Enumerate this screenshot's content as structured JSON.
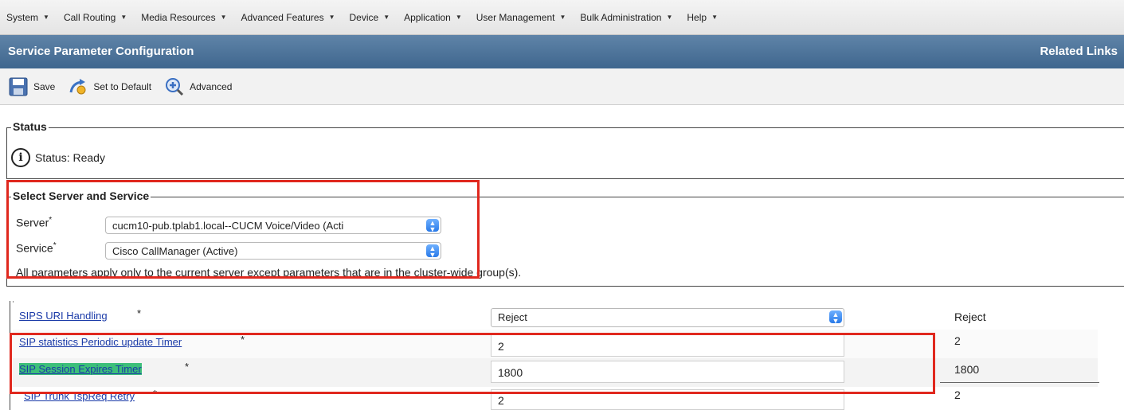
{
  "menu": [
    {
      "label": "System"
    },
    {
      "label": "Call Routing"
    },
    {
      "label": "Media Resources"
    },
    {
      "label": "Advanced Features"
    },
    {
      "label": "Device"
    },
    {
      "label": "Application"
    },
    {
      "label": "User Management"
    },
    {
      "label": "Bulk Administration"
    },
    {
      "label": "Help"
    }
  ],
  "header": {
    "title": "Service Parameter Configuration",
    "related_links": "Related Links"
  },
  "toolbar": {
    "save": "Save",
    "set_default": "Set to Default",
    "advanced": "Advanced"
  },
  "status_section": {
    "legend": "Status",
    "text": "Status: Ready"
  },
  "server_section": {
    "legend": "Select Server and Service",
    "server_label": "Server",
    "server_value": "cucm10-pub.tplab1.local--CUCM Voice/Video (Acti",
    "service_label": "Service",
    "service_value": "Cisco CallManager (Active)",
    "note": "All parameters apply only to the current server except parameters that are in the cluster-wide group(s)."
  },
  "required_mark": "*",
  "parameters": [
    {
      "name": "SIPS URI Handling",
      "value": "Reject",
      "default": "Reject"
    },
    {
      "name": "SIP statistics Periodic update Timer",
      "value": "2",
      "default": "2"
    },
    {
      "name": "SIP Session Expires Timer",
      "value": "1800",
      "default": "1800"
    },
    {
      "name": "SIP Trunk TspReq Retry",
      "value": "2",
      "default": "2"
    }
  ],
  "colors": {
    "title_bar": "#4a7099",
    "highlight": "#e0281e",
    "link": "#1a3aa8",
    "selected_text_bg": "#3dbf7a"
  }
}
